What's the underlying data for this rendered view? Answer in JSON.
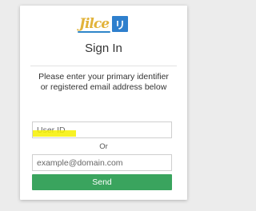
{
  "logo": {
    "text": "Jilce",
    "mark": "リ"
  },
  "title": "Sign In",
  "description": "Please enter your primary identifier or registered email address below",
  "user_id": {
    "placeholder": "User ID",
    "value": ""
  },
  "or_label": "Or",
  "email": {
    "placeholder": "example@domain.com",
    "value": ""
  },
  "send_label": "Send",
  "colors": {
    "send": "#3aa45e",
    "logo_blue": "#2e7fcd",
    "logo_gold": "#e2b33a",
    "highlight": "#f6f000"
  }
}
